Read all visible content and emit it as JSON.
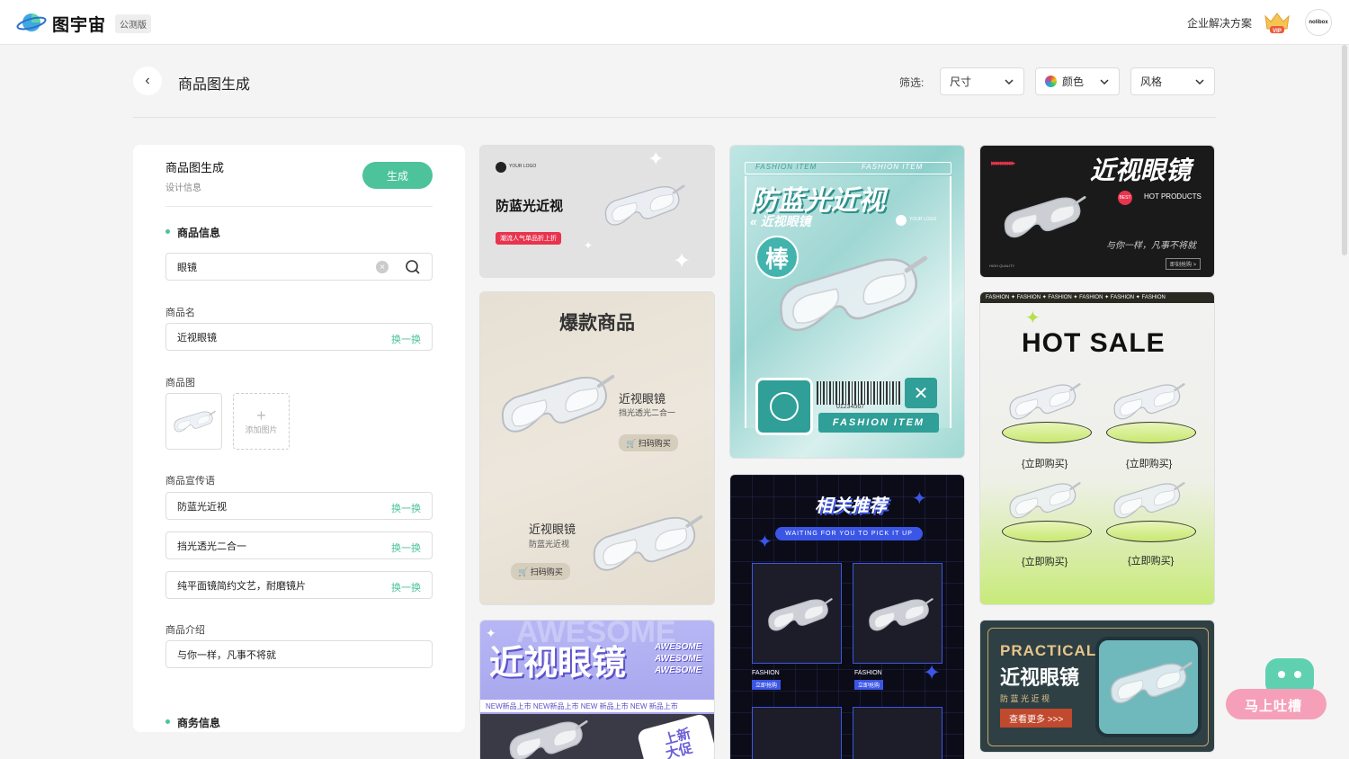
{
  "header": {
    "brand": "图宇宙",
    "beta_badge": "公测版",
    "enterprise_link": "企业解决方案",
    "vip_label": "VIP",
    "avatar_text": "nolibox"
  },
  "page": {
    "title": "商品图生成",
    "filter_label": "筛选:",
    "filters": {
      "size": "尺寸",
      "color": "颜色",
      "style": "风格"
    }
  },
  "panel": {
    "title": "商品图生成",
    "subtitle": "设计信息",
    "generate_button": "生成",
    "section_product": "商品信息",
    "search_value": "眼镜",
    "name_label": "商品名",
    "name_value": "近视眼镜",
    "swap_label": "换一换",
    "image_label": "商品图",
    "add_image": "添加图片",
    "slogan_label": "商品宣传语",
    "slogans": [
      "防蓝光近视",
      "挡光透光二合一",
      "纯平面镜简约文艺，耐磨镜片"
    ],
    "intro_label": "商品介绍",
    "intro_value": "与你一样，凡事不将就",
    "section_business": "商务信息"
  },
  "cards": {
    "c1": {
      "logo": "YOUR LOGO",
      "title": "防蓝光近视",
      "badge": "潮流人气单品折上折"
    },
    "c2": {
      "title": "爆款商品",
      "name1": "近视眼镜",
      "sub1": "挡光透光二合一",
      "btn1": "扫码购买",
      "name2": "近视眼镜",
      "sub2": "防蓝光近视",
      "btn2": "扫码购买"
    },
    "c3": {
      "title": "AWESOME",
      "main": "近视眼镜",
      "side1": "AWESOME",
      "side2": "AWESOME",
      "side3": "AWESOME",
      "strip": "NEW新品上市 NEW新品上市 NEW 新品上市 NEW 新品上市",
      "promo1": "上新",
      "promo2": "大促"
    },
    "c4": {
      "top1": "FASHION ITEM",
      "top2": "FASHION ITEM",
      "title": "防蓝光近视",
      "sub": "近视眼镜",
      "logo": "YOUR LOGO",
      "badge": "棒",
      "barcode": "01234567",
      "bottom": "FASHION ITEM"
    },
    "c5": {
      "title": "相关推荐",
      "sub": "WAITING FOR YOU TO PICK IT UP",
      "l1": "FASHION",
      "b1": "立即抢购",
      "l2": "FASHION",
      "b2": "立即抢购"
    },
    "c6": {
      "title": "近视眼镜",
      "hot": "HOT PRODUCTS",
      "slogan": "与你一样，凡事不将就",
      "tag": "BEST",
      "quality": "HIGH QUALITY",
      "btn": "即刻抢购 >"
    },
    "c7": {
      "ticker": "FASHION ✦ FASHION ✦ FASHION ✦ FASHION ✦ FASHION ✦ FASHION",
      "title": "HOT SALE",
      "buy1": "{立即购买}",
      "buy2": "{立即购买}",
      "buy3": "{立即购买}",
      "buy4": "{立即购买}"
    },
    "c8": {
      "title": "PRACTICAL",
      "main": "近视眼镜",
      "sub": "防 蓝 光 近 视",
      "btn": "查看更多 >>>"
    }
  },
  "feedback": {
    "label": "马上吐槽"
  },
  "colors": {
    "accent": "#4cc39a",
    "vip": "#f0b23a"
  }
}
